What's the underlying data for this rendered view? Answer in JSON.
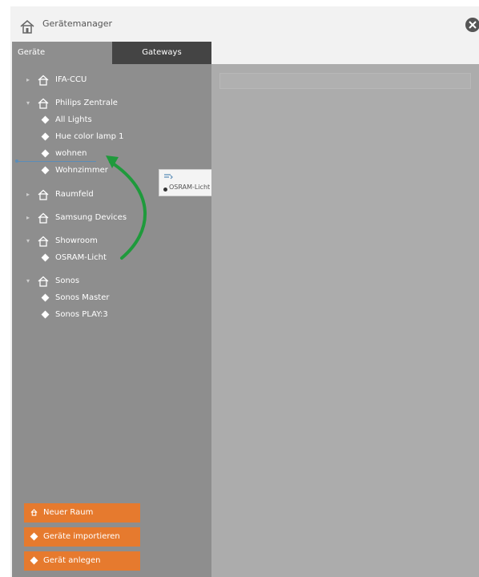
{
  "window": {
    "title": "Gerätemanager",
    "title_icon": "house-icon",
    "close_icon": "close-icon"
  },
  "sidebar": {
    "tabs": [
      {
        "label": "Geräte",
        "active": true
      },
      {
        "label": "Gateways",
        "active": false
      }
    ],
    "tree": [
      {
        "label": "IFA-CCU",
        "type": "group",
        "expanded": false
      },
      {
        "label": "Philips Zentrale",
        "type": "group",
        "expanded": true
      },
      {
        "label": "All Lights",
        "type": "device"
      },
      {
        "label": "Hue color lamp 1",
        "type": "device"
      },
      {
        "label": "wohnen",
        "type": "device"
      },
      {
        "label": "Wohnzimmer",
        "type": "device"
      },
      {
        "label": "Raumfeld",
        "type": "group",
        "expanded": false
      },
      {
        "label": "Samsung Devices",
        "type": "group",
        "expanded": false
      },
      {
        "label": "Showroom",
        "type": "group",
        "expanded": true
      },
      {
        "label": "OSRAM-Licht",
        "type": "device"
      },
      {
        "label": "Sonos",
        "type": "group",
        "expanded": true
      },
      {
        "label": "Sonos Master",
        "type": "device"
      },
      {
        "label": "Sonos PLAY:3",
        "type": "device"
      }
    ],
    "actions": [
      {
        "label": "Neuer Raum",
        "icon": "house-icon"
      },
      {
        "label": "Geräte importieren",
        "icon": "diamond-icon"
      },
      {
        "label": "Gerät anlegen",
        "icon": "diamond-icon"
      }
    ]
  },
  "drag_tooltip": {
    "label": "OSRAM-Licht"
  },
  "colors": {
    "sidebar_bg": "#8e8e8e",
    "tab_inactive_bg": "#444444",
    "content_bg": "#acacac",
    "button_orange": "#e67a2e",
    "arrow_green": "#1f9a3c"
  }
}
